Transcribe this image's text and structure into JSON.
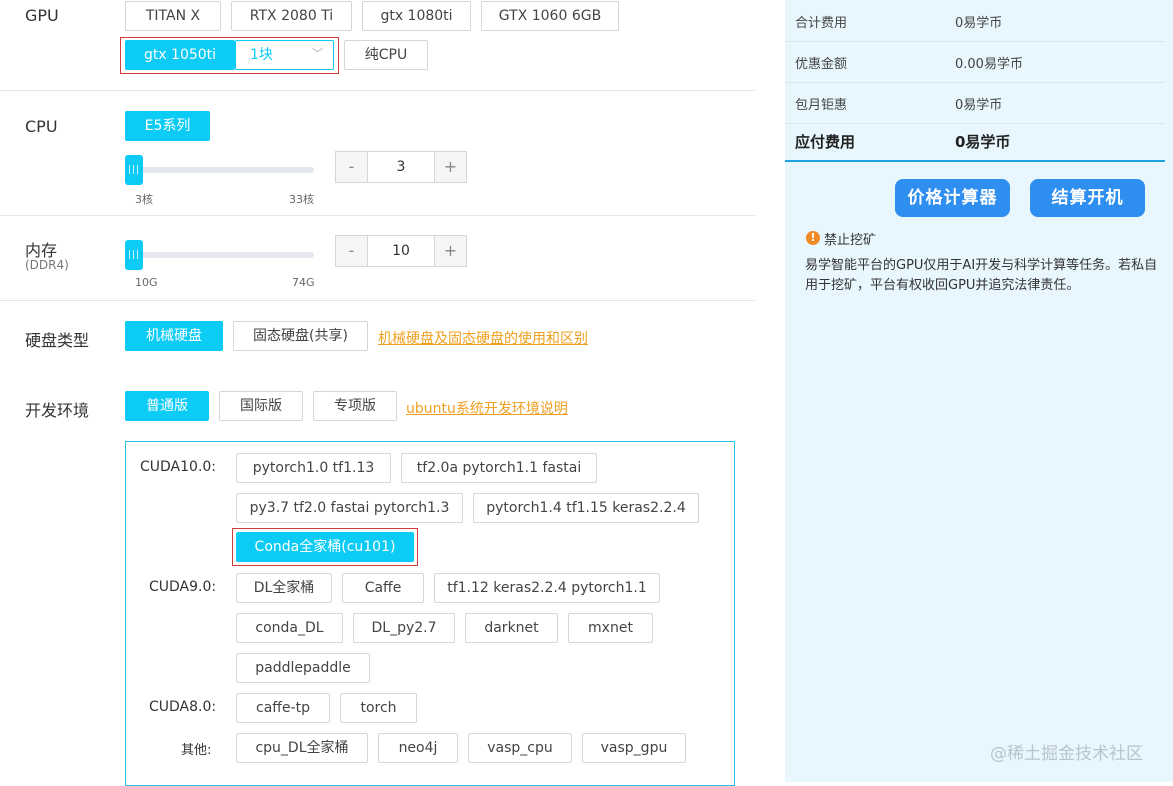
{
  "gpu": {
    "label": "GPU",
    "options": [
      "TITAN X",
      "RTX 2080 Ti",
      "gtx 1080ti",
      "GTX 1060 6GB"
    ],
    "selected": "gtx 1050ti",
    "count": "1块",
    "cpu_only": "纯CPU"
  },
  "cpu": {
    "label": "CPU",
    "series": "E5系列",
    "min": "3核",
    "max": "33核",
    "value": "3",
    "minus": "-",
    "plus": "+"
  },
  "memory": {
    "label": "内存",
    "sublabel": "(DDR4)",
    "min": "10G",
    "max": "74G",
    "value": "10",
    "minus": "-",
    "plus": "+"
  },
  "disk": {
    "label": "硬盘类型",
    "options": [
      "机械硬盘",
      "固态硬盘(共享)"
    ],
    "link": "机械硬盘及固态硬盘的使用和区别"
  },
  "env": {
    "label": "开发环境",
    "options": [
      "普通版",
      "国际版",
      "专项版"
    ],
    "link": "ubuntu系统开发环境说明",
    "cuda10": {
      "label": "CUDA10.0:",
      "items": [
        "pytorch1.0 tf1.13",
        "tf2.0a pytorch1.1 fastai",
        "py3.7 tf2.0 fastai pytorch1.3",
        "pytorch1.4 tf1.15 keras2.2.4",
        "Conda全家桶(cu101)"
      ]
    },
    "cuda9": {
      "label": "CUDA9.0:",
      "items": [
        "DL全家桶",
        "Caffe",
        "tf1.12 keras2.2.4 pytorch1.1",
        "conda_DL",
        "DL_py2.7",
        "darknet",
        "mxnet",
        "paddlepaddle"
      ]
    },
    "cuda8": {
      "label": "CUDA8.0:",
      "items": [
        "caffe-tp",
        "torch"
      ]
    },
    "other": {
      "label": "其他:",
      "items": [
        "cpu_DL全家桶",
        "neo4j",
        "vasp_cpu",
        "vasp_gpu"
      ]
    }
  },
  "fees": {
    "rows": [
      {
        "k": "合计费用",
        "v": "0易学币"
      },
      {
        "k": "优惠金额",
        "v": "0.00易学币"
      },
      {
        "k": "包月钜惠",
        "v": "0易学币"
      }
    ],
    "total_k": "应付费用",
    "total_v": "0易学币",
    "calc_button": "价格计算器",
    "checkout_button": "结算开机"
  },
  "notice": {
    "icon": "!",
    "title": "禁止挖矿",
    "text": "易学智能平台的GPU仅用于AI开发与科学计算等任务。若私自用于挖矿，平台有权收回GPU并追究法律责任。"
  },
  "watermark": "@稀土掘金技术社区",
  "colors": {
    "accent": "#0ccbf5",
    "link": "#f0a020",
    "button": "#2f8ff0",
    "panel": "#e8f7fd"
  }
}
